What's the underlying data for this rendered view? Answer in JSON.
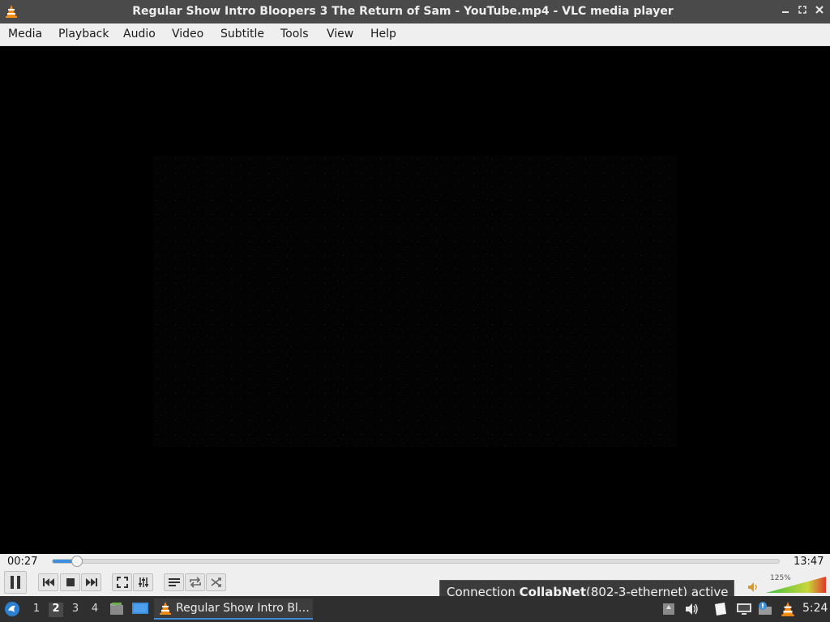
{
  "window": {
    "title": "Regular Show Intro Bloopers 3 The Return of Sam - YouTube.mp4 - VLC media player",
    "minimize_icon": "minimize-icon",
    "maximize_icon": "maximize-icon",
    "close_icon": "close-icon"
  },
  "menubar": {
    "items": [
      "Media",
      "Playback",
      "Audio",
      "Video",
      "Subtitle",
      "Tools",
      "View",
      "Help"
    ]
  },
  "player": {
    "elapsed": "00:27",
    "duration": "13:47",
    "progress_fraction": 0.033,
    "volume_label": "125%",
    "volume_fraction": 1.0
  },
  "tooltip": {
    "prefix": "Connection ",
    "name": "CollabNet",
    "suffix": "(802-3-ethernet) active"
  },
  "taskbar": {
    "workspaces": [
      "1",
      "2",
      "3",
      "4"
    ],
    "active_workspace": "2",
    "task_label": "Regular Show Intro Bl…",
    "clock": "5:24"
  },
  "colors": {
    "accent": "#3d8edb",
    "vlc_orange": "#f28c14",
    "taskbar_bg": "#2f2f2f"
  }
}
